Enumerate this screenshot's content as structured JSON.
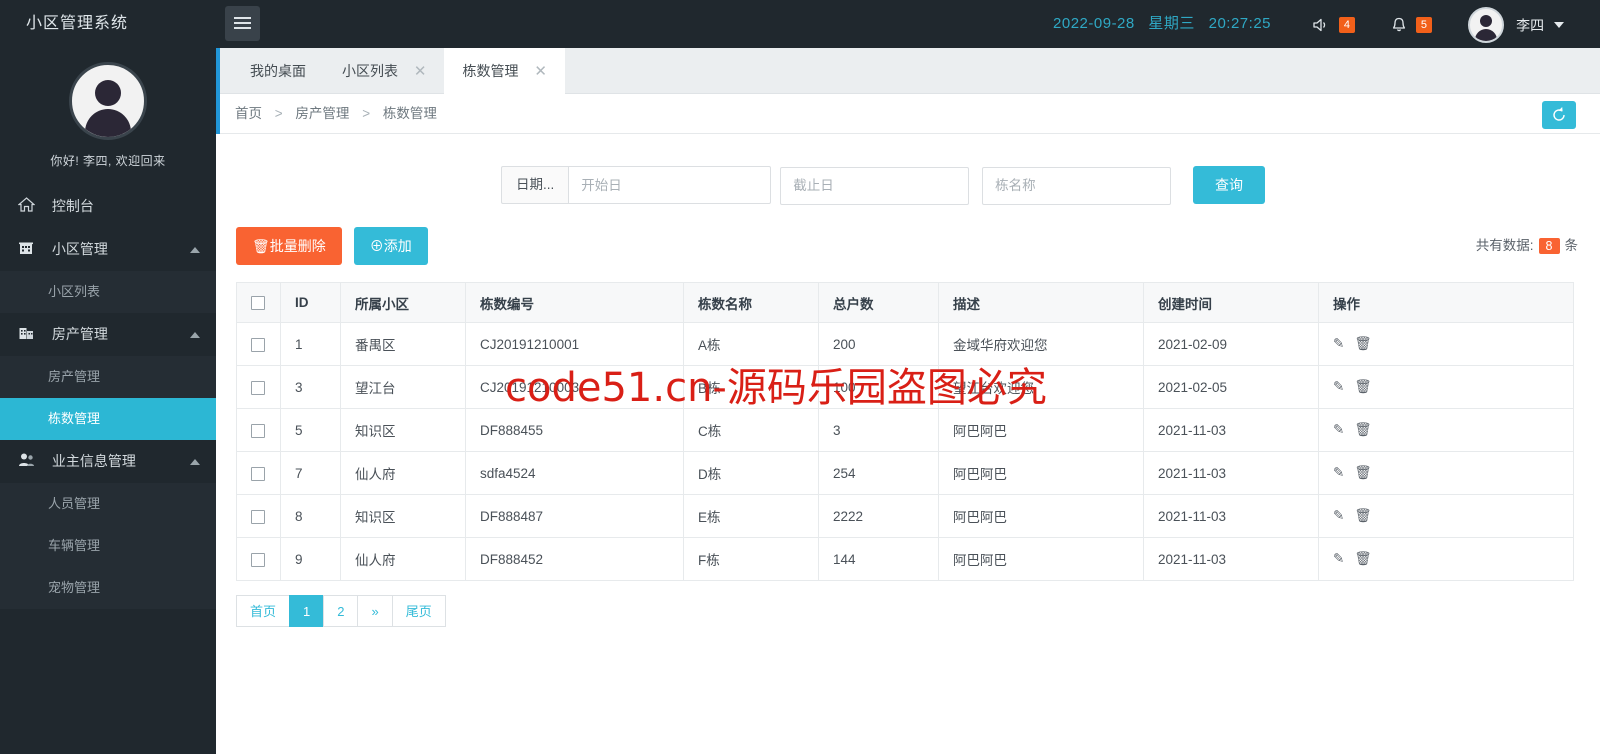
{
  "brand": {
    "title": "小区管理系统"
  },
  "sidebar": {
    "welcome": "你好! 李四, 欢迎回来",
    "items": [
      {
        "label": "控制台",
        "icon": "home-icon",
        "type": "item",
        "expandable": false
      },
      {
        "label": "小区管理",
        "icon": "building-icon",
        "type": "item",
        "expandable": true
      },
      {
        "label": "小区列表",
        "type": "sub",
        "active": false
      },
      {
        "label": "房产管理",
        "icon": "office-icon",
        "type": "item",
        "expandable": true
      },
      {
        "label": "房产管理",
        "type": "sub",
        "active": false
      },
      {
        "label": "栋数管理",
        "type": "sub",
        "active": true
      },
      {
        "label": "业主信息管理",
        "icon": "users-icon",
        "type": "item",
        "expandable": true
      },
      {
        "label": "人员管理",
        "type": "sub",
        "active": false
      },
      {
        "label": "车辆管理",
        "type": "sub",
        "active": false
      },
      {
        "label": "宠物管理",
        "type": "sub",
        "active": false
      }
    ]
  },
  "topbar": {
    "date": "2022-09-28",
    "weekday": "星期三",
    "time": "20:27:25",
    "sound_badge": "4",
    "bell_badge": "5",
    "user_name": "李四"
  },
  "tabs": [
    {
      "label": "我的桌面",
      "closable": false,
      "active": false
    },
    {
      "label": "小区列表",
      "closable": true,
      "active": false
    },
    {
      "label": "栋数管理",
      "closable": true,
      "active": true
    }
  ],
  "breadcrumb": {
    "items": [
      "首页",
      "房产管理",
      "栋数管理"
    ],
    "separator": ">"
  },
  "search": {
    "date_addon": "日期...",
    "start_placeholder": "开始日",
    "start_value": "",
    "end_placeholder": "截止日",
    "end_value": "",
    "name_placeholder": "栋名称",
    "name_value": "",
    "query_label": "查询"
  },
  "actions": {
    "bulk_delete_label": "批量删除",
    "add_label": "添加",
    "total_prefix": "共有数据:",
    "total_count": "8",
    "total_suffix": "条"
  },
  "table": {
    "headers": [
      "",
      "ID",
      "所属小区",
      "栋数编号",
      "栋数名称",
      "总户数",
      "描述",
      "创建时间",
      "操作"
    ],
    "rows": [
      {
        "id": "1",
        "community": "番禺区",
        "code": "CJ20191210001",
        "name": "A栋",
        "households": "200",
        "desc": "金域华府欢迎您",
        "created": "2021-02-09"
      },
      {
        "id": "3",
        "community": "望江台",
        "code": "CJ20191210003",
        "name": "B栋",
        "households": "100",
        "desc": "望江台欢迎您",
        "created": "2021-02-05"
      },
      {
        "id": "5",
        "community": "知识区",
        "code": "DF888455",
        "name": "C栋",
        "households": "3",
        "desc": "阿巴阿巴",
        "created": "2021-11-03"
      },
      {
        "id": "7",
        "community": "仙人府",
        "code": "sdfa4524",
        "name": "D栋",
        "households": "254",
        "desc": "阿巴阿巴",
        "created": "2021-11-03"
      },
      {
        "id": "8",
        "community": "知识区",
        "code": "DF888487",
        "name": "E栋",
        "households": "2222",
        "desc": "阿巴阿巴",
        "created": "2021-11-03"
      },
      {
        "id": "9",
        "community": "仙人府",
        "code": "DF888452",
        "name": "F栋",
        "households": "144",
        "desc": "阿巴阿巴",
        "created": "2021-11-03"
      }
    ]
  },
  "pagination": [
    {
      "label": "首页",
      "active": false
    },
    {
      "label": "1",
      "active": true
    },
    {
      "label": "2",
      "active": false
    },
    {
      "label": "»",
      "active": false
    },
    {
      "label": "尾页",
      "active": false
    }
  ],
  "watermark": {
    "text": "code51.cn-源码乐园盗图必究"
  },
  "colors": {
    "sidebar_bg": "#20282e",
    "accent": "#34bbd8",
    "danger": "#f96332",
    "datetime": "#2fa8c4",
    "tab_accent": "#2196d8"
  }
}
